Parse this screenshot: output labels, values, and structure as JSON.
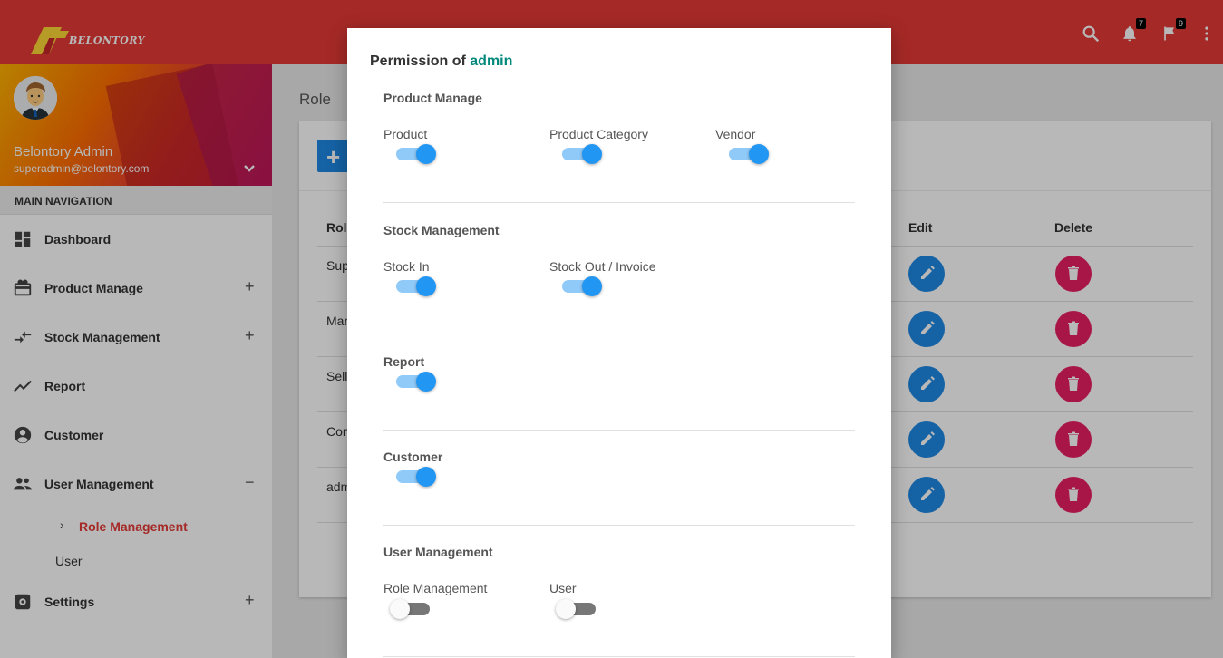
{
  "app": {
    "logo_text": "BELONTORY"
  },
  "topbar": {
    "notifications_count": "7",
    "flags_count": "9"
  },
  "sidebar": {
    "user_name": "Belontory Admin",
    "user_email": "superadmin@belontory.com",
    "nav_header": "MAIN NAVIGATION",
    "items": [
      {
        "label": "Dashboard",
        "icon": "dashboard-icon",
        "expand": ""
      },
      {
        "label": "Product Manage",
        "icon": "gift-icon",
        "expand": "+"
      },
      {
        "label": "Stock Management",
        "icon": "compare-arrows-icon",
        "expand": "+"
      },
      {
        "label": "Report",
        "icon": "trending-up-icon",
        "expand": ""
      },
      {
        "label": "Customer",
        "icon": "account-circle-icon",
        "expand": ""
      },
      {
        "label": "User Management",
        "icon": "people-icon",
        "expand": "−"
      },
      {
        "label": "Settings",
        "icon": "settings-icon",
        "expand": "+"
      }
    ],
    "subitems": [
      {
        "label": "Role Management",
        "active": true
      },
      {
        "label": "User",
        "active": false
      }
    ]
  },
  "page": {
    "title": "Role",
    "table": {
      "headers": {
        "role": "Role",
        "edit": "Edit",
        "delete": "Delete"
      },
      "rows": [
        "Sup",
        "Man",
        "Sell",
        "Con",
        "adm"
      ]
    }
  },
  "modal": {
    "title_prefix": "Permission of",
    "role_name": "admin",
    "sections": [
      {
        "title": "Product Manage",
        "permissions": [
          {
            "label": "Product",
            "enabled": true
          },
          {
            "label": "Product Category",
            "enabled": true
          },
          {
            "label": "Vendor",
            "enabled": true
          }
        ]
      },
      {
        "title": "Stock Management",
        "permissions": [
          {
            "label": "Stock In",
            "enabled": true
          },
          {
            "label": "Stock Out / Invoice",
            "enabled": true
          }
        ]
      },
      {
        "title": "Report",
        "enabled": true
      },
      {
        "title": "Customer",
        "enabled": true
      },
      {
        "title": "User Management",
        "permissions": [
          {
            "label": "Role Management",
            "enabled": false
          },
          {
            "label": "User",
            "enabled": false
          }
        ]
      }
    ]
  },
  "colors": {
    "topbar": "#e53935",
    "accent": "#1e88e5",
    "delete": "#e91e63",
    "role_highlight": "#00897b",
    "active_nav": "#e53935"
  }
}
